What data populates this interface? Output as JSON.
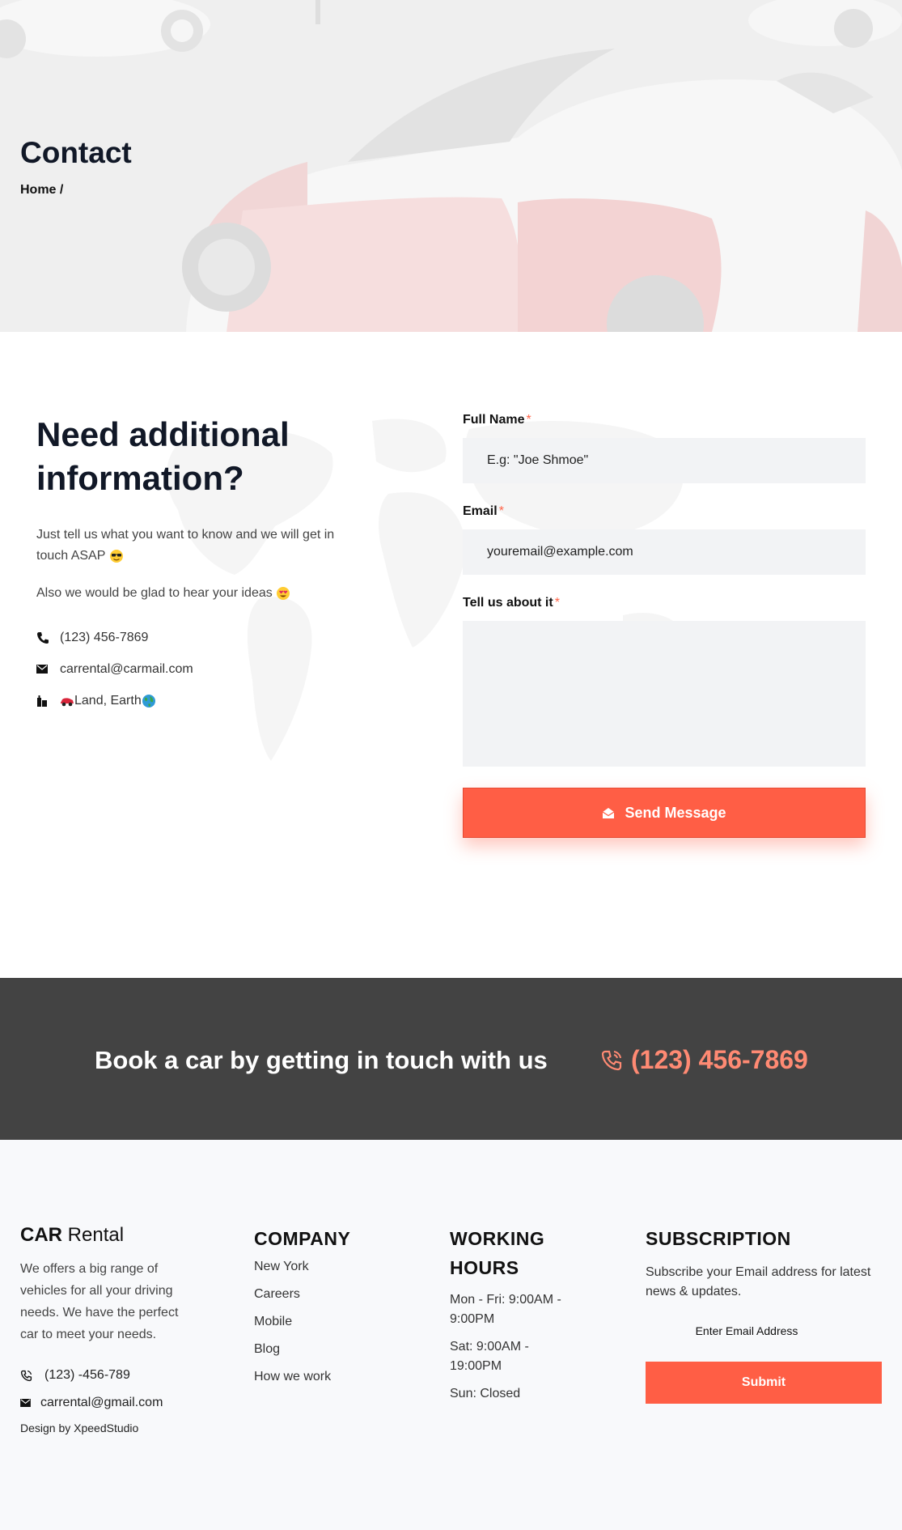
{
  "hero": {
    "title": "Contact",
    "breadcrumb": "Home /"
  },
  "contact": {
    "heading": "Need additional information?",
    "intro": "Just tell us what you want to know and we will get in touch ASAP",
    "ideas": "Also we would be glad to hear your ideas",
    "phone": "(123) 456-7869",
    "email": "carrental@carmail.com",
    "address": "Land, Earth",
    "icons": [
      "phone-icon",
      "envelope-icon",
      "building-icon",
      "car-emoji",
      "globe-emoji",
      "sunglasses-emoji",
      "heart-eyes-emoji"
    ]
  },
  "form": {
    "name_label": "Full Name",
    "name_placeholder": "E.g: \"Joe Shmoe\"",
    "email_label": "Email",
    "email_placeholder": "youremail@example.com",
    "message_label": "Tell us about it",
    "required_mark": "*",
    "send_label": "Send Message"
  },
  "cta": {
    "text": "Book a car by getting in touch with us",
    "phone": "(123) 456-7869"
  },
  "footer": {
    "brand_bold": "CAR",
    "brand_rest": " Rental",
    "description": "We offers a big range of vehicles for all your driving needs. We have the perfect car to meet your needs.",
    "phone": "(123) -456-789",
    "email": "carrental@gmail.com",
    "design": "Design by XpeedStudio",
    "company": {
      "title": "COMPANY",
      "links": [
        "New York",
        "Careers",
        "Mobile",
        "Blog",
        "How we work"
      ]
    },
    "hours": {
      "title": "WORKING HOURS",
      "lines": [
        "Mon - Fri: 9:00AM - 9:00PM",
        "Sat: 9:00AM - 19:00PM",
        "Sun: Closed"
      ]
    },
    "subscription": {
      "title": "SUBSCRIPTION",
      "text": "Subscribe your Email address for latest news & updates.",
      "placeholder": "Enter Email Address",
      "button": "Submit"
    }
  },
  "colors": {
    "accent": "#ff5e45",
    "cta_bg": "#434343",
    "cta_phone": "#ff8a73",
    "footer_bg": "#f8f9fb",
    "input_bg": "#f2f3f5"
  }
}
